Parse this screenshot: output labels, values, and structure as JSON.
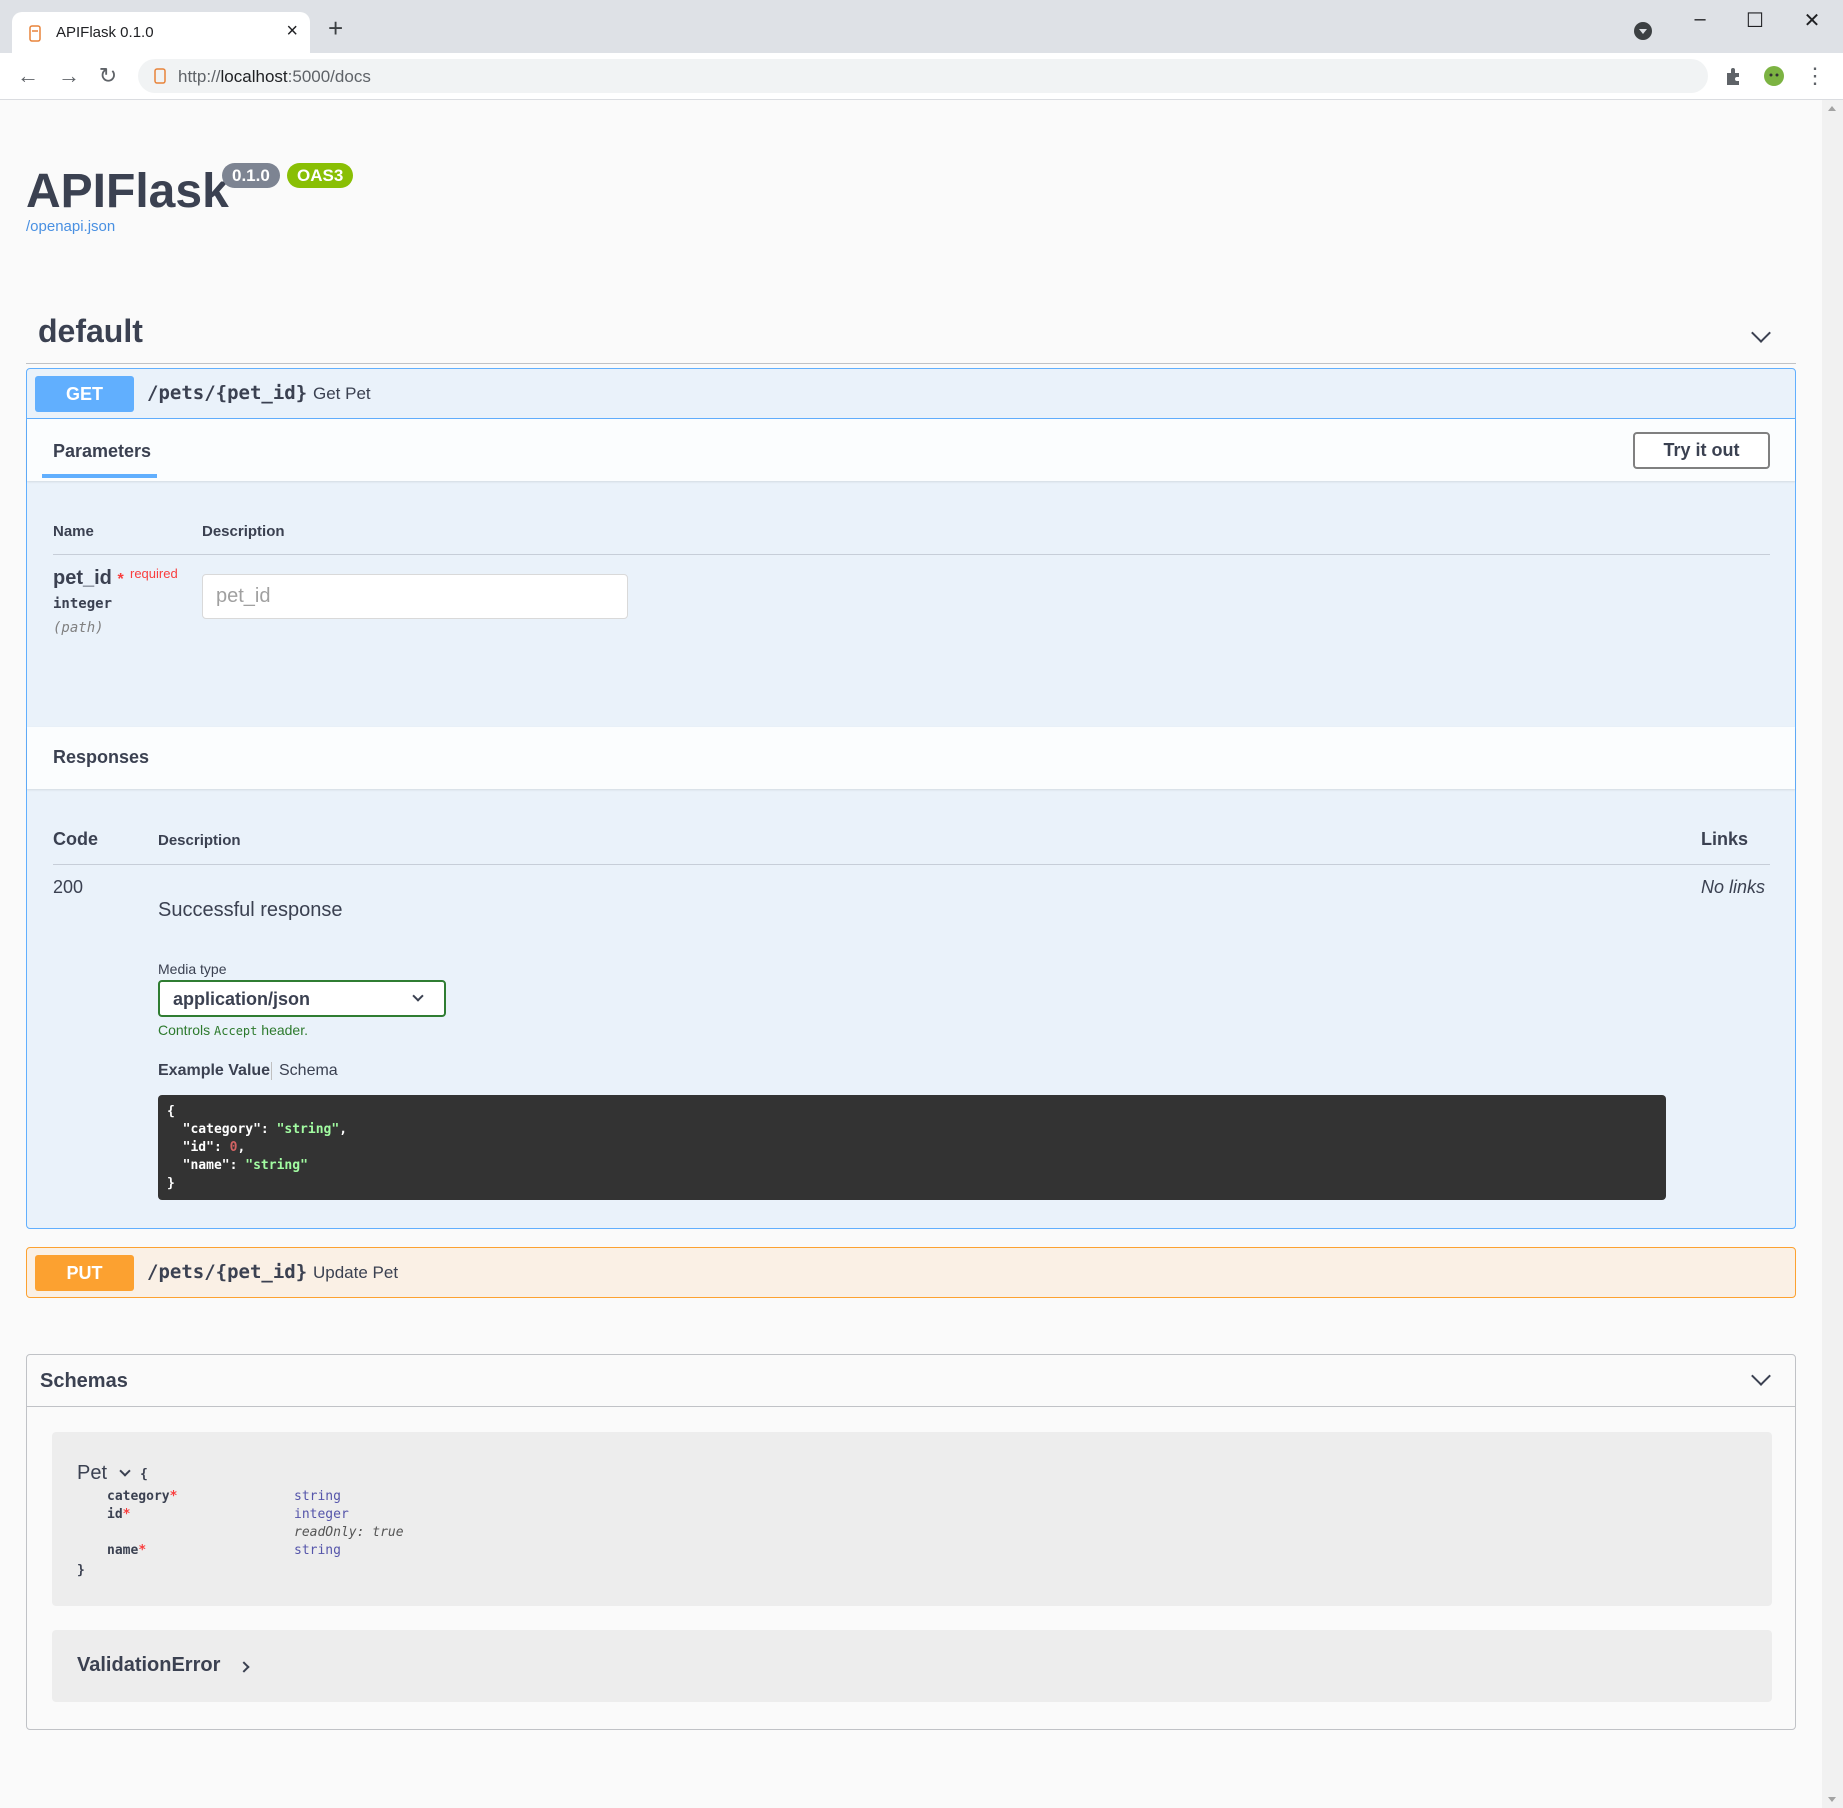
{
  "browser": {
    "tab_title": "APIFlask 0.1.0",
    "tab_close": "×",
    "new_tab": "+",
    "url_prefix": "http://",
    "url_host": "localhost",
    "url_rest": ":5000/docs",
    "window_controls": {
      "minimize": "–",
      "maximize": "☐",
      "close": "✕"
    },
    "nav": {
      "back": "←",
      "forward": "→",
      "reload": "↻",
      "menu": "⋮"
    }
  },
  "header": {
    "title": "APIFlask",
    "version_badge": "0.1.0",
    "oas_badge": "OAS3",
    "spec_link": "/openapi.json"
  },
  "tag": {
    "name": "default"
  },
  "get_op": {
    "method": "GET",
    "path": "/pets/{pet_id}",
    "summary": "Get Pet",
    "parameters_tab": "Parameters",
    "try_it_out": "Try it out",
    "columns": {
      "name": "Name",
      "description": "Description"
    },
    "param": {
      "name": "pet_id",
      "star": "*",
      "required": "required",
      "type": "integer",
      "in": "(path)",
      "placeholder": "pet_id"
    },
    "responses": {
      "title": "Responses",
      "columns": {
        "code": "Code",
        "description": "Description",
        "links": "Links"
      },
      "code": "200",
      "description": "Successful response",
      "links": "No links",
      "media_type_label": "Media type",
      "media_type": "application/json",
      "controls_prefix": "Controls ",
      "controls_code": "Accept",
      "controls_suffix": " header.",
      "example_tab": "Example Value",
      "schema_tab": "Schema",
      "example_lines": [
        "{",
        "  \"category\": ",
        "\"string\"",
        ",",
        "  \"id\": ",
        "0",
        ",",
        "  \"name\": ",
        "\"string\"",
        "}"
      ]
    }
  },
  "put_op": {
    "method": "PUT",
    "path": "/pets/{pet_id}",
    "summary": "Update Pet"
  },
  "schemas": {
    "title": "Schemas",
    "pet": {
      "name": "Pet",
      "open": "{",
      "close": "}",
      "props": [
        {
          "name": "category",
          "type": "string",
          "meta": ""
        },
        {
          "name": "id",
          "type": "integer",
          "meta": "readOnly: true"
        },
        {
          "name": "name",
          "type": "string",
          "meta": ""
        }
      ]
    },
    "validation_error": {
      "name": "ValidationError"
    }
  },
  "colors": {
    "get": "#61affe",
    "put": "#fca130",
    "badge_version": "#7d8492",
    "badge_oas": "#89bf04",
    "link": "#4990e2",
    "required": "#f93e3e"
  }
}
